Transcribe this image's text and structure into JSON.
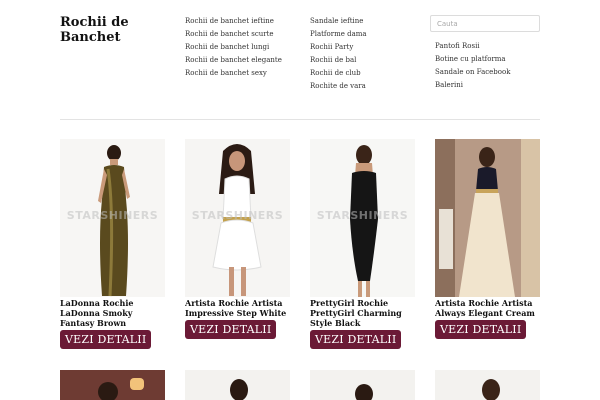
{
  "site": {
    "title": "Rochii de Banchet"
  },
  "nav": {
    "col1": [
      "Rochii de banchet ieftine",
      "Rochii de banchet scurte",
      "Rochii de banchet lungi",
      "Rochii de banchet elegante",
      "Rochii de banchet sexy"
    ],
    "col2": [
      "Sandale ieftine",
      "Platforme dama",
      "Rochii Party",
      "Rochii de bal",
      "Rochii de club",
      "Rochite de vara"
    ],
    "col3": [
      "Pantofi Rosii",
      "Botine cu platforma",
      "Sandale on Facebook",
      "Balerini"
    ]
  },
  "search": {
    "placeholder": "Cauta"
  },
  "products": [
    {
      "title": "LaDonna Rochie LaDonna Smoky Fantasy Brown",
      "button": "VEZI DETALII",
      "watermark": "STARSHINERS"
    },
    {
      "title": "Artista Rochie Artista Impressive Step White",
      "button": "VEZI DETALII",
      "watermark": "STARSHINERS"
    },
    {
      "title": "PrettyGirl Rochie PrettyGirl Charming Style Black",
      "button": "VEZI DETALII",
      "watermark": "STARSHINERS"
    },
    {
      "title": "Artista Rochie Artista Always Elegant Cream",
      "button": "VEZI DETALII",
      "watermark": ""
    }
  ],
  "colors": {
    "button_bg": "#6b1a36",
    "divider": "#e3e3e3"
  }
}
